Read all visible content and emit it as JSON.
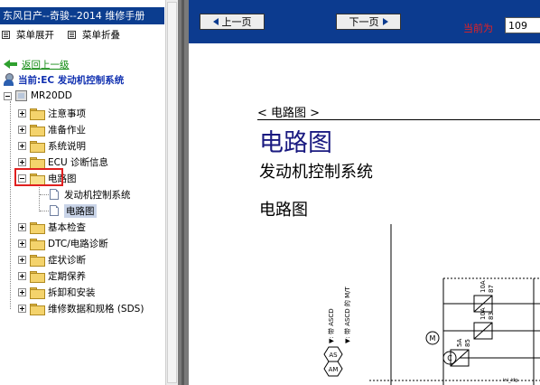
{
  "left": {
    "title": "东风日产--奇骏--2014 维修手册",
    "expand_all": "菜单展开",
    "collapse_all": "菜单折叠",
    "back": "返回上一级",
    "current": "当前:EC 发动机控制系统",
    "root": "MR20DD",
    "items": [
      "注意事项",
      "准备作业",
      "系统说明",
      "ECU 诊断信息",
      "电路图",
      "基本检查",
      "DTC/电路诊断",
      "症状诊断",
      "定期保养",
      "拆卸和安装",
      "维修数据和规格 (SDS)"
    ],
    "sub_items": [
      "发动机控制系统",
      "电路图"
    ]
  },
  "nav": {
    "prev": "上一页",
    "next": "下一页",
    "page_label": "当前为",
    "page_value": "109"
  },
  "doc": {
    "section_tag": "< 电路图 >",
    "section_title": "电路图",
    "system_title": "发动机控制系统",
    "diagram_title": "电路图"
  },
  "diagram": {
    "labels": {
      "as": "AS",
      "am": "AM",
      "m": "M",
      "c": "C",
      "asc_at": "▼: 带 ASCD",
      "asc_mt": "▼: 带 ASCD 的 M/T",
      "fuse1_amp": "10A",
      "fuse1_num": "87",
      "fuse2_amp": "10A",
      "fuse2_num": "83",
      "fuse3_amp": "5A",
      "fuse3_num": "85",
      "corner": "ini_idg"
    }
  }
}
